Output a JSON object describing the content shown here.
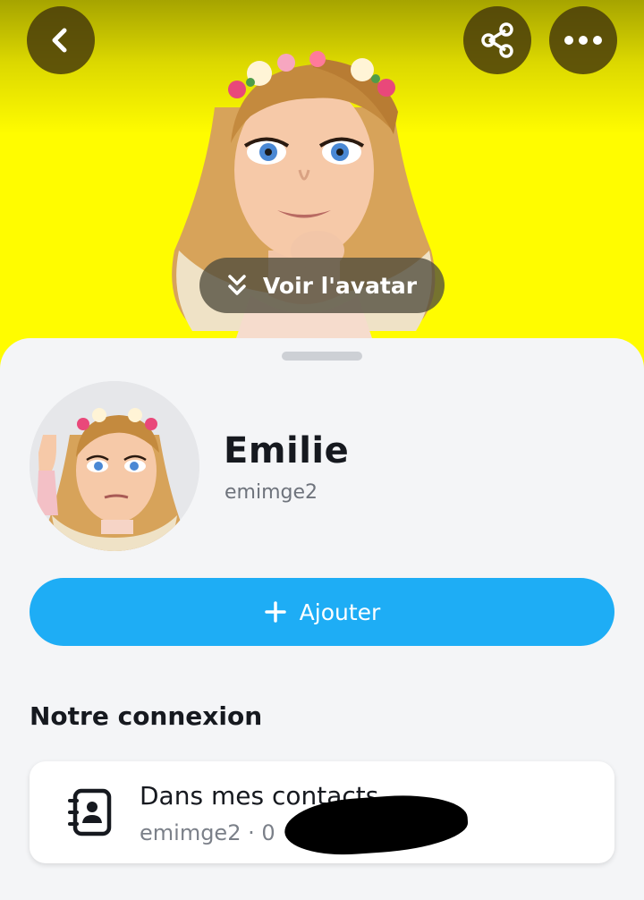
{
  "header": {
    "view_avatar_label": "Voir l'avatar",
    "background_color": "#fffc00"
  },
  "profile": {
    "display_name": "Emilie",
    "username": "emimge2"
  },
  "actions": {
    "add_label": "Ajouter",
    "add_color": "#1eadf5"
  },
  "connection": {
    "section_title": "Notre connexion",
    "contact_title": "Dans mes contacts",
    "contact_subtitle": "emimge2 · 0"
  },
  "icons": {
    "back": "chevron-left-icon",
    "share": "share-icon",
    "more": "more-horizontal-icon",
    "view_avatar": "double-chevron-down-icon",
    "add": "plus-icon",
    "contact": "address-book-icon"
  }
}
